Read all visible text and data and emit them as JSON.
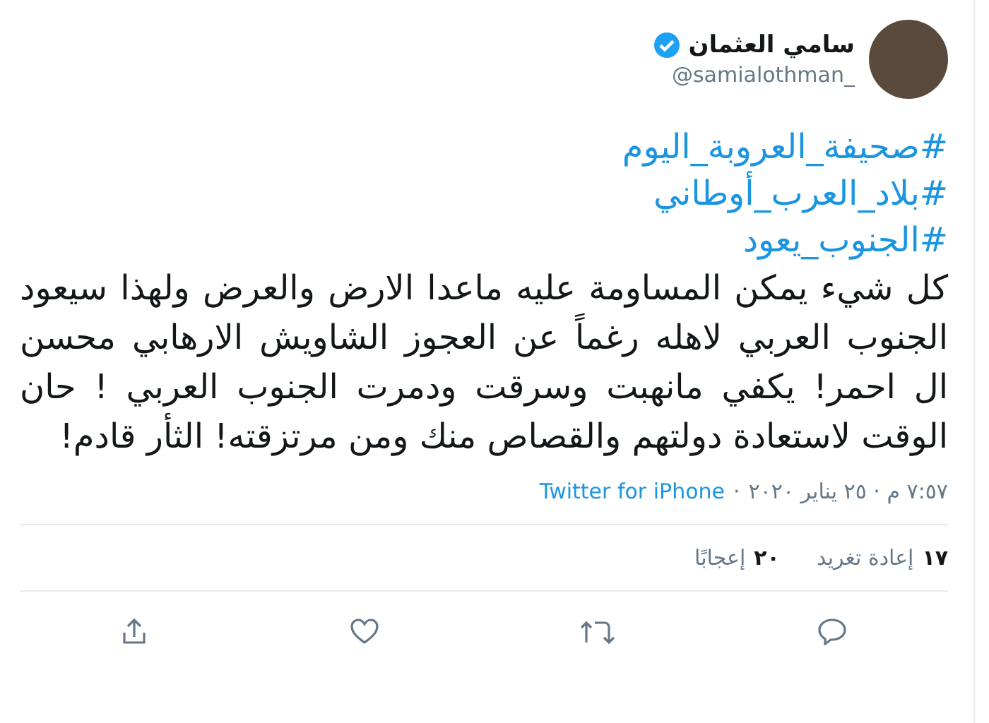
{
  "tweet": {
    "author": {
      "name": "سامي العثمان",
      "verified": true,
      "handle": "@samialothman_"
    },
    "hashtags": [
      "#صحيفة_العروبة_اليوم",
      "#بلاد_العرب_أوطاني",
      "#الجنوب_يعود"
    ],
    "body": "كل شيء يمكن المساومة عليه ماعدا الارض والعرض ولهذا سيعود الجنوب العربي لاهله رغماً عن العجوز الشاويش الارهابي محسن ال احمر! يكفي مانهبت وسرقت ودمرت الجنوب العربي ! حان الوقت لاستعادة دولتهم والقصاص منك ومن مرتزقته! الثأر قادم!",
    "timestamp": "٧:٥٧ م · ٢٥ يناير ٢٠٢٠",
    "separator": "·",
    "source": "Twitter for iPhone",
    "stats": [
      {
        "count": "١٧",
        "label": "إعادة تغريد"
      },
      {
        "count": "٢٠",
        "label": "إعجابًا"
      }
    ],
    "actions": [
      {
        "kind": "reply"
      },
      {
        "kind": "retweet"
      },
      {
        "kind": "like"
      },
      {
        "kind": "share"
      }
    ]
  }
}
